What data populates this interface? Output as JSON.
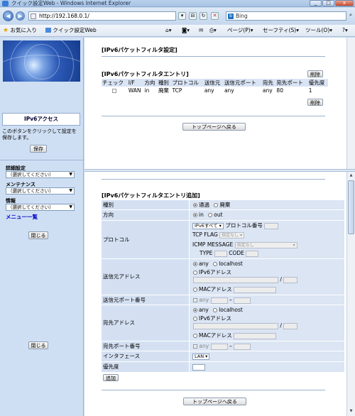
{
  "window": {
    "title": "クイック設定Web - Windows Internet Explorer",
    "min": "_",
    "max": "□",
    "close": "x"
  },
  "address": {
    "url": "http://192.168.0.1/",
    "search_placeholder": "Bing"
  },
  "favbar": {
    "favorites": "お気に入り",
    "tab": "クイック設定Web",
    "page_menu": "ページ(P)",
    "safety_menu": "セーフティ(S)",
    "tools_menu": "ツール(O)",
    "help_menu": "?"
  },
  "sidebar": {
    "section": "IPv6アクセス",
    "description": "このボタンをクリックして設定を保存します。",
    "save": "保存",
    "groups": [
      {
        "label": "詳細設定",
        "select": "（選択してください）"
      },
      {
        "label": "メンテナンス",
        "select": "（選択してください）"
      },
      {
        "label": "情報",
        "select": "（選択してください）"
      }
    ],
    "menu_all": "メニュー一覧",
    "close1": "閉じる",
    "close2": "閉じる"
  },
  "top": {
    "heading": "[IPv6パケットフィルタ設定]",
    "table_heading": "[IPv6パケットフィルタエントリ]",
    "delete": "削除",
    "columns": [
      "チェック",
      "I/F",
      "方向",
      "種別",
      "プロトコル",
      "送信元",
      "送信元ポート",
      "宛先",
      "宛先ポート",
      "優先度"
    ],
    "row": [
      "",
      "WAN",
      "in",
      "廃棄",
      "TCP",
      "any",
      "any",
      "any",
      "80",
      "1"
    ],
    "back": "トップページへ戻る"
  },
  "add": {
    "heading": "[IPv6パケットフィルタエントリ追加]",
    "type_label": "種別",
    "type_options": [
      "通過",
      "廃棄"
    ],
    "dir_label": "方向",
    "dir_options": [
      "in",
      "out"
    ],
    "proto_label": "プロトコル",
    "proto_select": "IPv6すべて",
    "proto_num": "プロトコル番号",
    "tcp_flag": "TCP FLAG",
    "tcp_flag_select": "指定なし",
    "icmp": "ICMP MESSAGE",
    "icmp_select": "指定なし",
    "type": "TYPE",
    "code": "CODE",
    "src_label": "送信元アドレス",
    "any": "any",
    "localhost": "localhost",
    "ipv6addr": "IPv6アドレス",
    "macaddr": "MACアドレス",
    "slash": "/",
    "srcport_label": "送信元ポート番号",
    "dash": "–",
    "dst_label": "宛先アドレス",
    "dstport_label": "宛先ポート番号",
    "if_label": "インタフェース",
    "if_select": "LAN",
    "prio_label": "優先度",
    "add_btn": "追加",
    "back": "トップページへ戻る"
  }
}
